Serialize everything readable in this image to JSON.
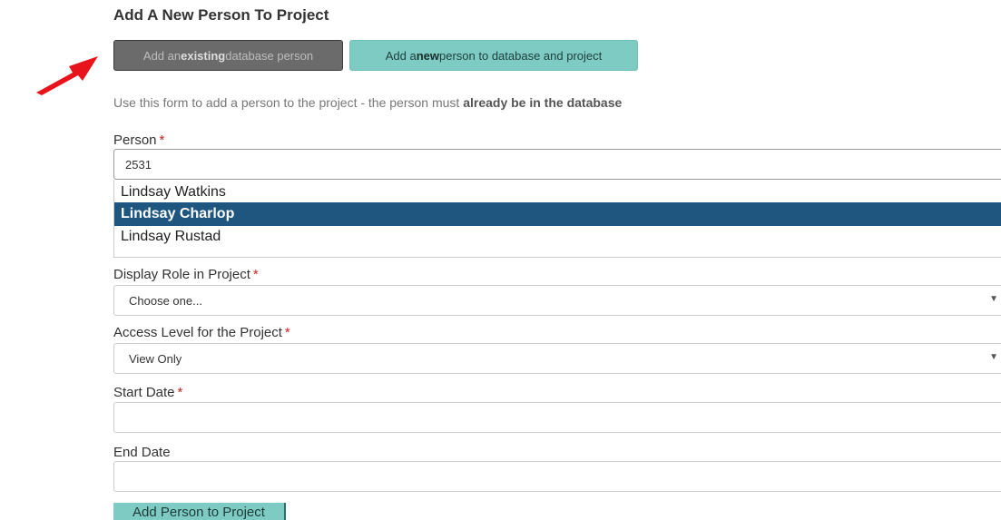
{
  "form": {
    "title": "Add A New Person To Project",
    "mode_buttons": {
      "existing": {
        "pre": "Add an ",
        "bold": "existing",
        "post": " database person"
      },
      "new": {
        "pre": "Add a ",
        "bold": "new",
        "post": " person to database and project"
      }
    },
    "intro": {
      "text": "Use this form to add a person to the project - the person must ",
      "bold": "already be in the database"
    },
    "required_marker": "*",
    "person": {
      "label": "Person",
      "value": "2531",
      "suggestions": [
        {
          "name": "Lindsay Watkins"
        },
        {
          "name": "Lindsay Charlop"
        },
        {
          "name": "Lindsay Rustad"
        }
      ]
    },
    "role": {
      "label": "Display Role in Project",
      "value": "Choose one..."
    },
    "access": {
      "label": "Access Level for the Project",
      "value": "View Only"
    },
    "start_date": {
      "label": "Start Date",
      "value": ""
    },
    "end_date": {
      "label": "End Date",
      "value": ""
    },
    "submit_label": "Add Person to Project"
  },
  "colors": {
    "teal": "#7ecbc4",
    "dark_button": "#6b6b6b",
    "highlight": "#1e5680",
    "required": "#cc2222",
    "annotation_arrow": "#e8141c"
  },
  "icons": {
    "select_caret": "chevron-down-icon",
    "annotation": "red-arrow-icon"
  }
}
